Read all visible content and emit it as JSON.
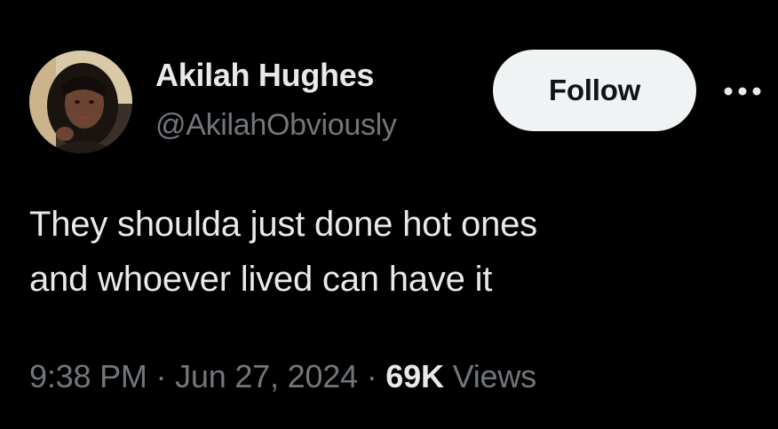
{
  "author": {
    "display_name": "Akilah Hughes",
    "handle": "@AkilahObviously",
    "avatar_icon": "profile-photo"
  },
  "actions": {
    "follow_label": "Follow",
    "more_icon": "more-options-icon"
  },
  "tweet": {
    "text_lines": [
      "They shoulda just done hot ones",
      "and whoever lived can have it"
    ]
  },
  "meta": {
    "time": "9:38 PM",
    "separator": "·",
    "date": "Jun 27, 2024",
    "views_count": "69K",
    "views_label": "Views"
  },
  "colors": {
    "background": "#000000",
    "primary_text": "#e7e9ea",
    "secondary_text": "#71767b",
    "follow_bg": "#eff3f4",
    "follow_text": "#0f1419"
  }
}
